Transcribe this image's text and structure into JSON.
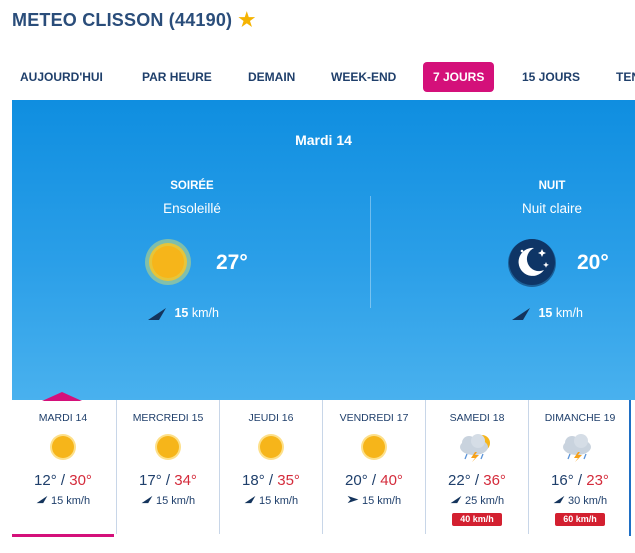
{
  "header": {
    "title": "METEO CLISSON (44190)",
    "favorite_icon": "star-icon"
  },
  "tabs": [
    {
      "label": "AUJOURD'HUI",
      "active": false
    },
    {
      "label": "PAR HEURE",
      "active": false
    },
    {
      "label": "DEMAIN",
      "active": false
    },
    {
      "label": "WEEK-END",
      "active": false
    },
    {
      "label": "7 JOURS",
      "active": true
    },
    {
      "label": "15 JOURS",
      "active": false
    },
    {
      "label": "TEN",
      "active": false
    }
  ],
  "detail": {
    "date": "Mardi 14",
    "periods": [
      {
        "title": "SOIRÉE",
        "desc": "Ensoleillé",
        "icon": "sun-icon",
        "temp": "27°",
        "wind_speed": "15",
        "wind_unit": "km/h"
      },
      {
        "title": "NUIT",
        "desc": "Nuit claire",
        "icon": "moon-stars-icon",
        "temp": "20°",
        "wind_speed": "15",
        "wind_unit": "km/h"
      }
    ]
  },
  "days": [
    {
      "name": "MARDI 14",
      "icon": "sun-icon",
      "min": "12°",
      "sep": " / ",
      "max": "30°",
      "wind": "15",
      "unit": "km/h",
      "gust": ""
    },
    {
      "name": "MERCREDI 15",
      "icon": "sun-icon",
      "min": "17°",
      "sep": " / ",
      "max": "34°",
      "wind": "15",
      "unit": "km/h",
      "gust": ""
    },
    {
      "name": "JEUDI 16",
      "icon": "sun-icon",
      "min": "18°",
      "sep": " / ",
      "max": "35°",
      "wind": "15",
      "unit": "km/h",
      "gust": ""
    },
    {
      "name": "VENDREDI 17",
      "icon": "sun-icon",
      "min": "20°",
      "sep": " / ",
      "max": "40°",
      "wind": "15",
      "unit": "km/h",
      "gust": ""
    },
    {
      "name": "SAMEDI 18",
      "icon": "storm-cloud-icon",
      "min": "22°",
      "sep": " / ",
      "max": "36°",
      "wind": "25",
      "unit": "km/h",
      "gust": "40 km/h"
    },
    {
      "name": "DIMANCHE 19",
      "icon": "storm-cloud-icon",
      "min": "16°",
      "sep": " / ",
      "max": "23°",
      "wind": "30",
      "unit": "km/h",
      "gust": "60 km/h"
    }
  ],
  "colors": {
    "accent": "#d4107a",
    "panel": "#1a93e3",
    "text": "#1f3f6b",
    "max_temp": "#d42b3b",
    "sun": "#f5b301"
  }
}
